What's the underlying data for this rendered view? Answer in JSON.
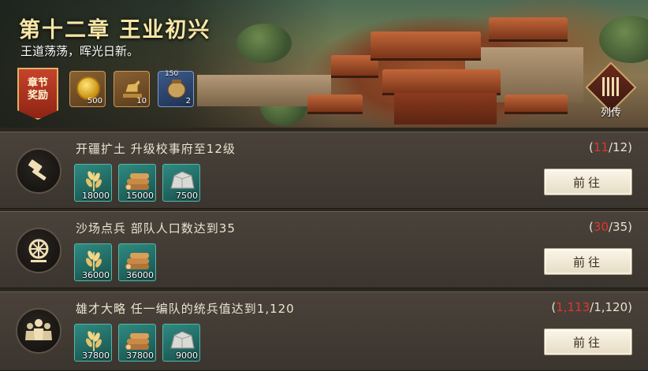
{
  "chapter": {
    "title": "第十二章 王业初兴",
    "subtitle": "王道荡荡，晖光日新。",
    "reward_label": "章节\n奖励",
    "rewards": [
      {
        "icon": "gold-coin-icon",
        "amount": "500"
      },
      {
        "icon": "bronze-horse-icon",
        "amount": "10"
      },
      {
        "icon": "supply-box-icon",
        "amount": "2",
        "top_amount": "150"
      }
    ],
    "biography_button": "列传"
  },
  "tasks": [
    {
      "icon": "hammer-icon",
      "name": "开疆扩土 升级校事府至12级",
      "progress_open": "(",
      "progress_current": "11",
      "progress_total": "/12)",
      "resources": [
        {
          "icon": "grain-icon",
          "amount": "18000"
        },
        {
          "icon": "wood-icon",
          "amount": "15000"
        },
        {
          "icon": "stone-icon",
          "amount": "7500"
        }
      ],
      "button": "前往"
    },
    {
      "icon": "wheel-icon",
      "name": "沙场点兵 部队人口数达到35",
      "progress_open": "(",
      "progress_current": "30",
      "progress_total": "/35)",
      "resources": [
        {
          "icon": "grain-icon",
          "amount": "36000"
        },
        {
          "icon": "wood-icon",
          "amount": "36000"
        }
      ],
      "button": "前往"
    },
    {
      "icon": "soldiers-icon",
      "name": "雄才大略 任一编队的统兵值达到1,120",
      "progress_open": "(",
      "progress_current": "1,113",
      "progress_total": "/1,120)",
      "resources": [
        {
          "icon": "grain-icon",
          "amount": "37800"
        },
        {
          "icon": "wood-icon",
          "amount": "37800"
        },
        {
          "icon": "stone-icon",
          "amount": "9000"
        }
      ],
      "button": "前往"
    }
  ]
}
